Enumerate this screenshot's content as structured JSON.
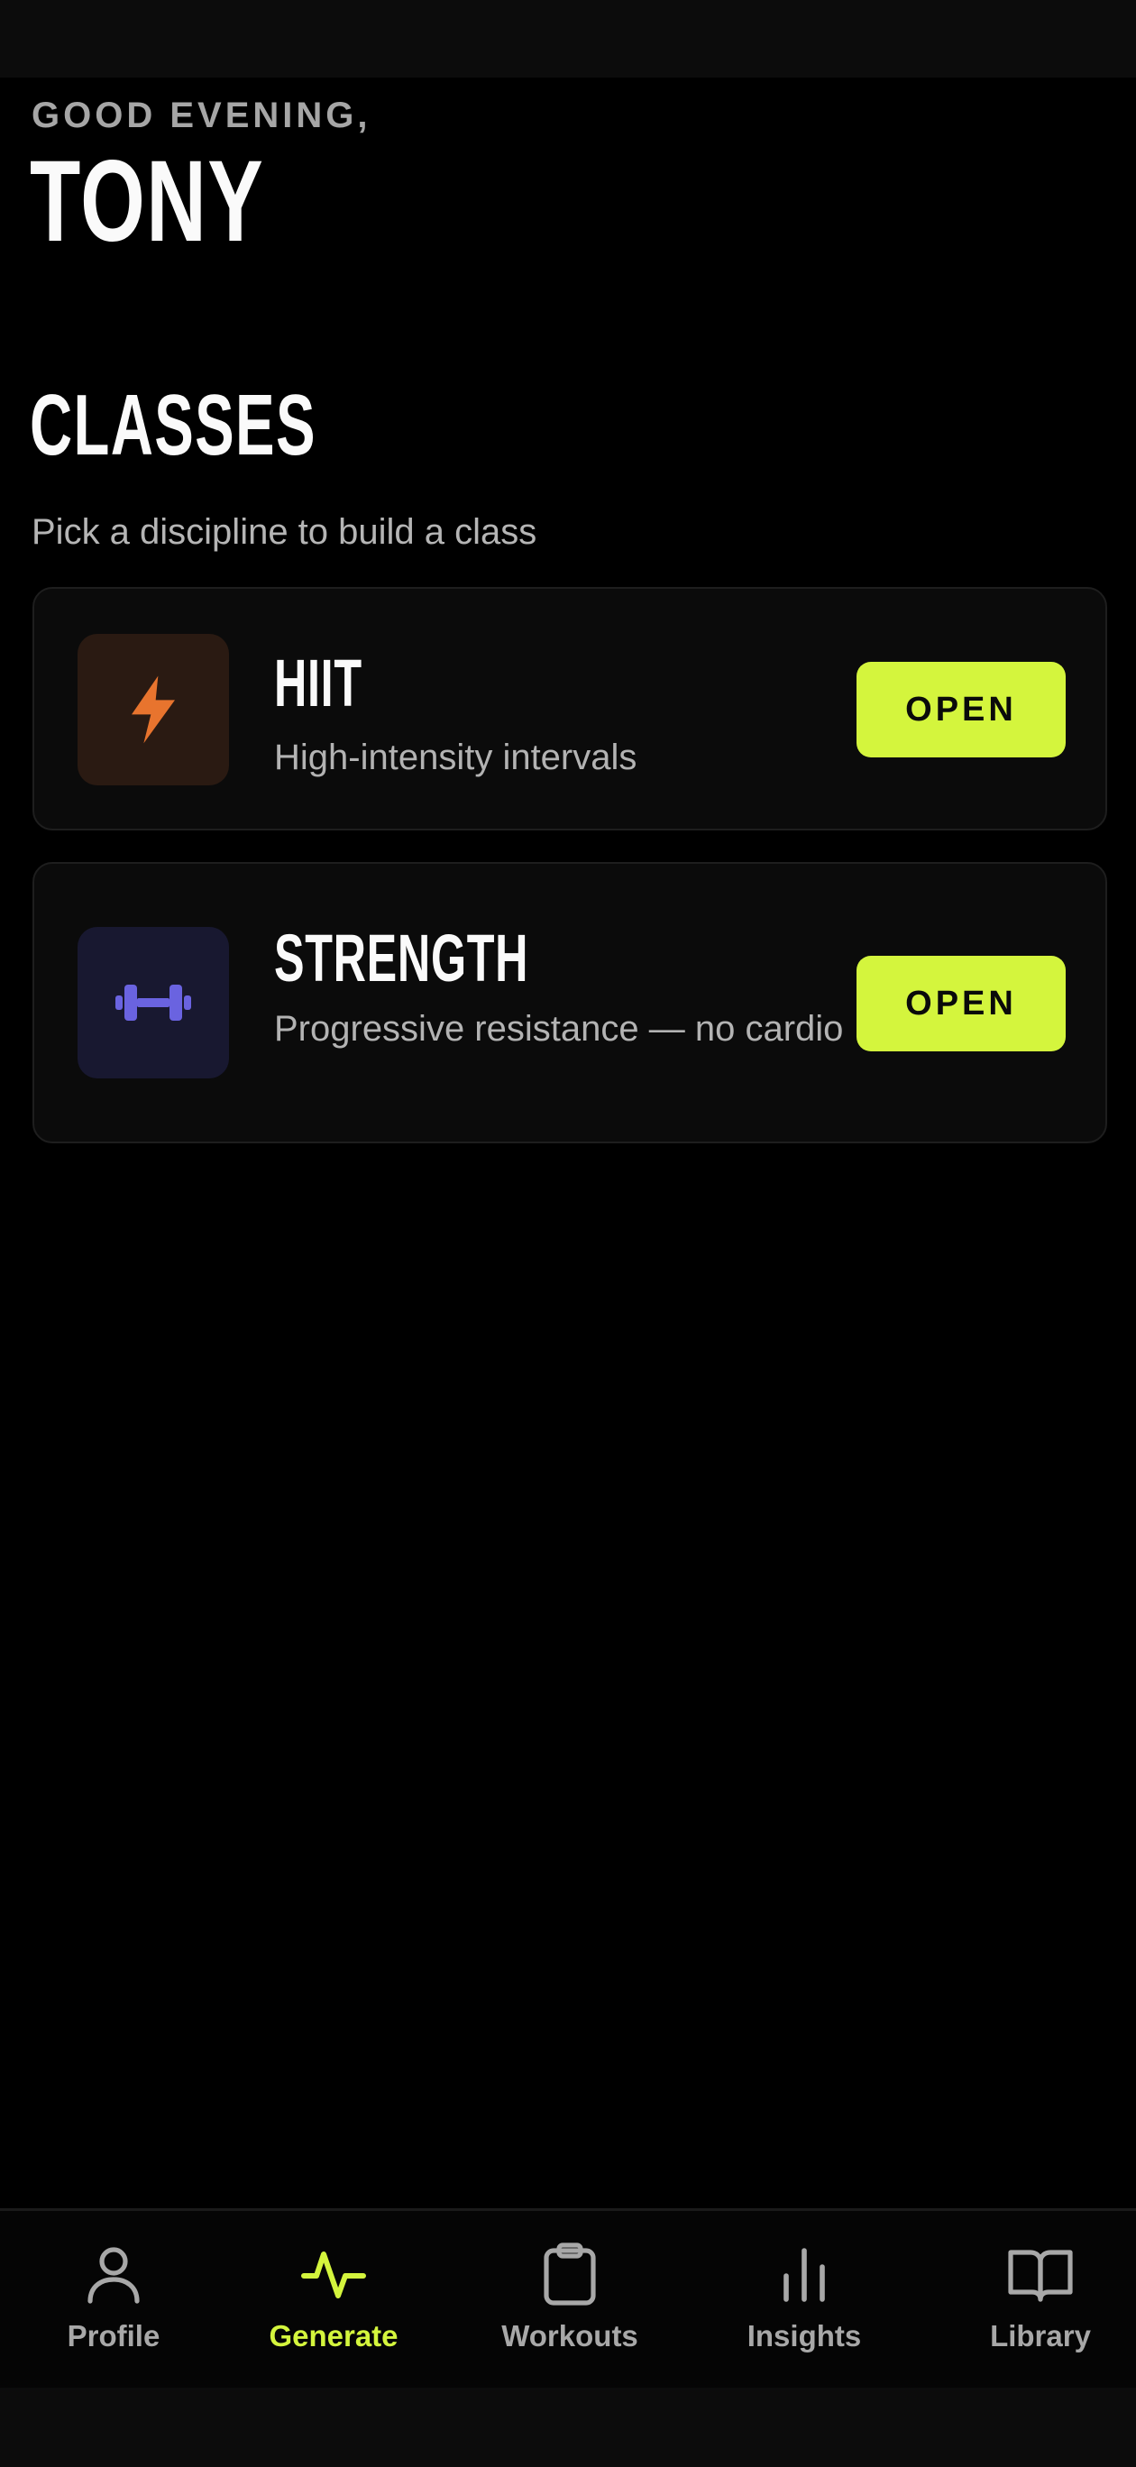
{
  "header": {
    "greeting": "GOOD EVENING,",
    "user_name": "TONY"
  },
  "classes": {
    "title": "CLASSES",
    "subtitle": "Pick a discipline to build a class",
    "items": [
      {
        "name": "HIIT",
        "description": "High-intensity intervals",
        "button_label": "OPEN",
        "icon": "lightning-bolt-icon",
        "icon_color": "#e8742e"
      },
      {
        "name": "STRENGTH",
        "description": "Progressive resistance — no cardio",
        "button_label": "OPEN",
        "icon": "dumbbell-icon",
        "icon_color": "#6a63e0"
      }
    ]
  },
  "bottom_nav": {
    "active": "Generate",
    "items": [
      {
        "label": "Profile",
        "icon": "person-icon"
      },
      {
        "label": "Generate",
        "icon": "activity-pulse-icon"
      },
      {
        "label": "Workouts",
        "icon": "clipboard-icon"
      },
      {
        "label": "Insights",
        "icon": "bar-chart-icon"
      },
      {
        "label": "Library",
        "icon": "open-book-icon"
      }
    ]
  },
  "colors": {
    "accent": "#d4f53d",
    "background": "#000000",
    "card": "#0b0b0b"
  }
}
